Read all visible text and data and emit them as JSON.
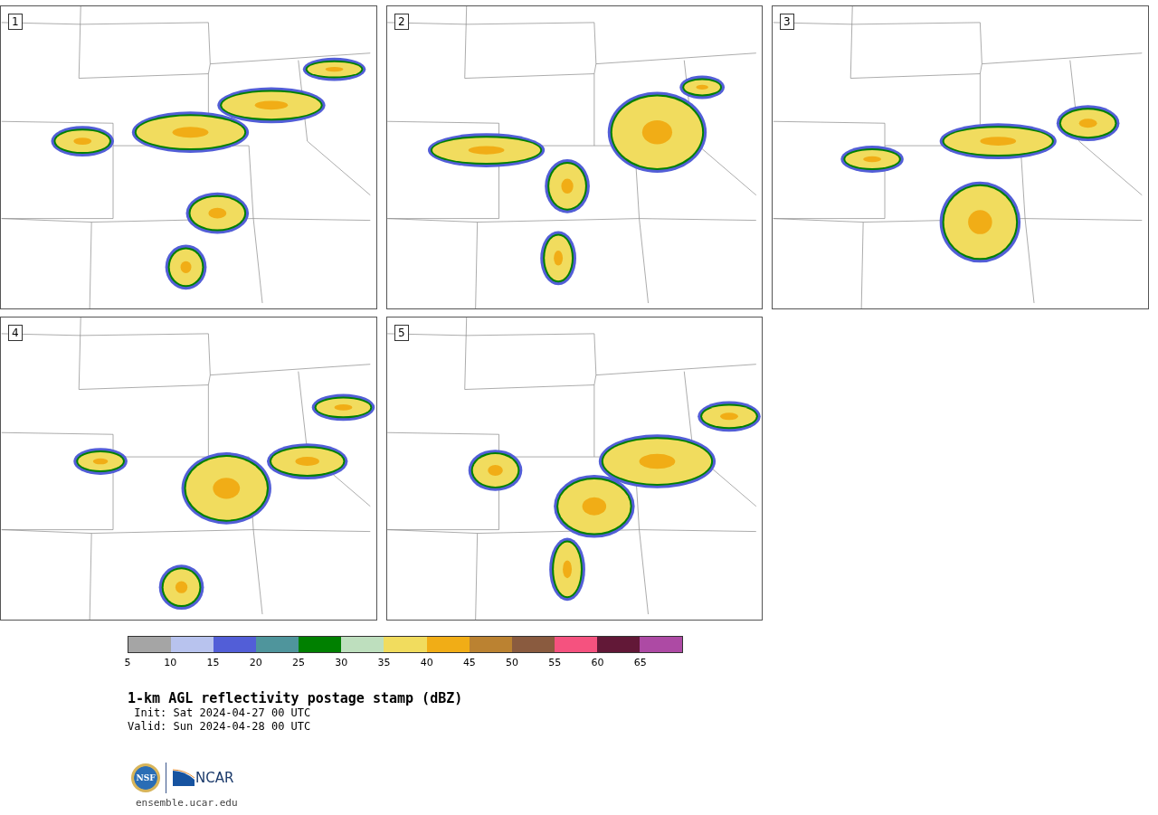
{
  "panels": [
    {
      "label": "1"
    },
    {
      "label": "2"
    },
    {
      "label": "3"
    },
    {
      "label": "4"
    },
    {
      "label": "5"
    }
  ],
  "colorbar": {
    "bins": [
      {
        "color": "#a5a5a5"
      },
      {
        "color": "#b8c3ee"
      },
      {
        "color": "#525ed7"
      },
      {
        "color": "#4f959c"
      },
      {
        "color": "#008000"
      },
      {
        "color": "#bedfbe"
      },
      {
        "color": "#f1dc5e"
      },
      {
        "color": "#f1ad16"
      },
      {
        "color": "#bb8231"
      },
      {
        "color": "#8a5b3f"
      },
      {
        "color": "#f5527f"
      },
      {
        "color": "#621837"
      },
      {
        "color": "#ad4aa4"
      }
    ],
    "ticks": [
      "5",
      "10",
      "15",
      "20",
      "25",
      "30",
      "35",
      "40",
      "45",
      "50",
      "55",
      "60",
      "65"
    ]
  },
  "title": "1-km AGL reflectivity postage stamp (dBZ)",
  "init": " Init: Sat 2024-04-27 00 UTC",
  "valid": "Valid: Sun 2024-04-28 00 UTC",
  "logos": {
    "nsf": "NSF",
    "ncar": "NCAR"
  },
  "url": "ensemble.ucar.edu"
}
